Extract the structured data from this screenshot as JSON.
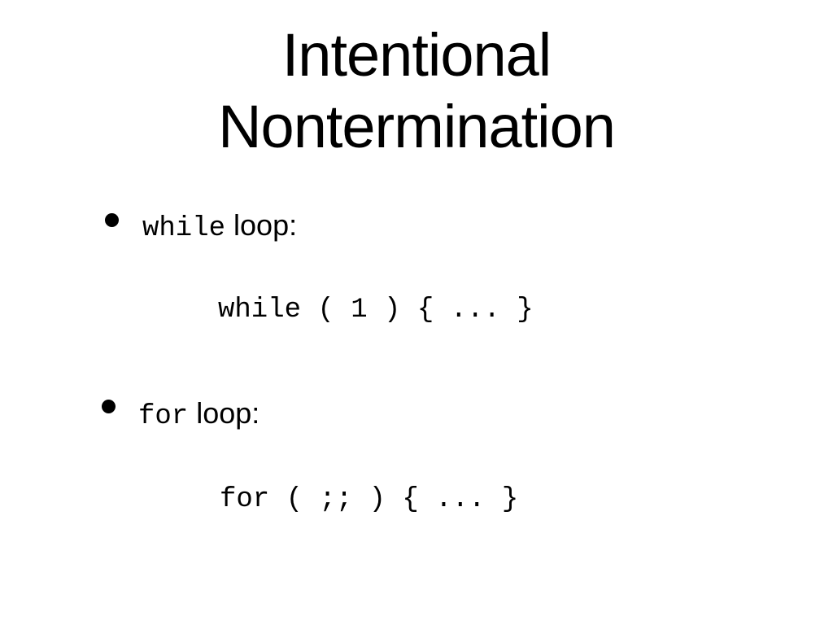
{
  "slide": {
    "title_line1": "Intentional",
    "title_line2": "Nontermination",
    "bullets": [
      {
        "keyword": "while",
        "label": " loop:",
        "code": "while ( 1 ) { ... }"
      },
      {
        "keyword": "for",
        "label": " loop:",
        "code": "for ( ;; ) { ... }"
      }
    ]
  }
}
